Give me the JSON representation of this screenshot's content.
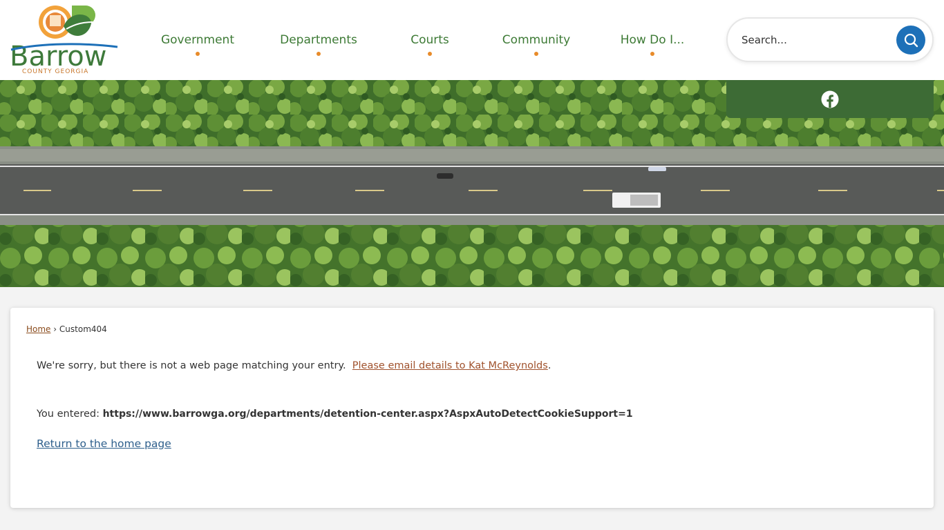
{
  "logo": {
    "name": "Barrow",
    "sub": "COUNTY GEORGIA"
  },
  "nav": {
    "items": [
      {
        "label": "Government"
      },
      {
        "label": "Departments"
      },
      {
        "label": "Courts"
      },
      {
        "label": "Community"
      },
      {
        "label": "How Do I..."
      }
    ]
  },
  "search": {
    "placeholder": "Search..."
  },
  "social": {
    "icon": "facebook-icon"
  },
  "breadcrumb": {
    "home": "Home",
    "separator": "›",
    "current": "Custom404"
  },
  "content": {
    "sorry_text": "We're sorry, but there is not a web page matching your entry.",
    "email_link": "Please email details to Kat McReynolds",
    "period": ".",
    "entered_label": "You entered:",
    "entered_url": "https://www.barrowga.org/departments/detention-center.aspx?AspxAutoDetectCookieSupport=1",
    "return_link": "Return to the home page"
  },
  "colors": {
    "brand_green": "#3d7a35",
    "accent_orange": "#e88b2a",
    "search_blue": "#1d70b8",
    "social_green": "#3d6b35"
  }
}
